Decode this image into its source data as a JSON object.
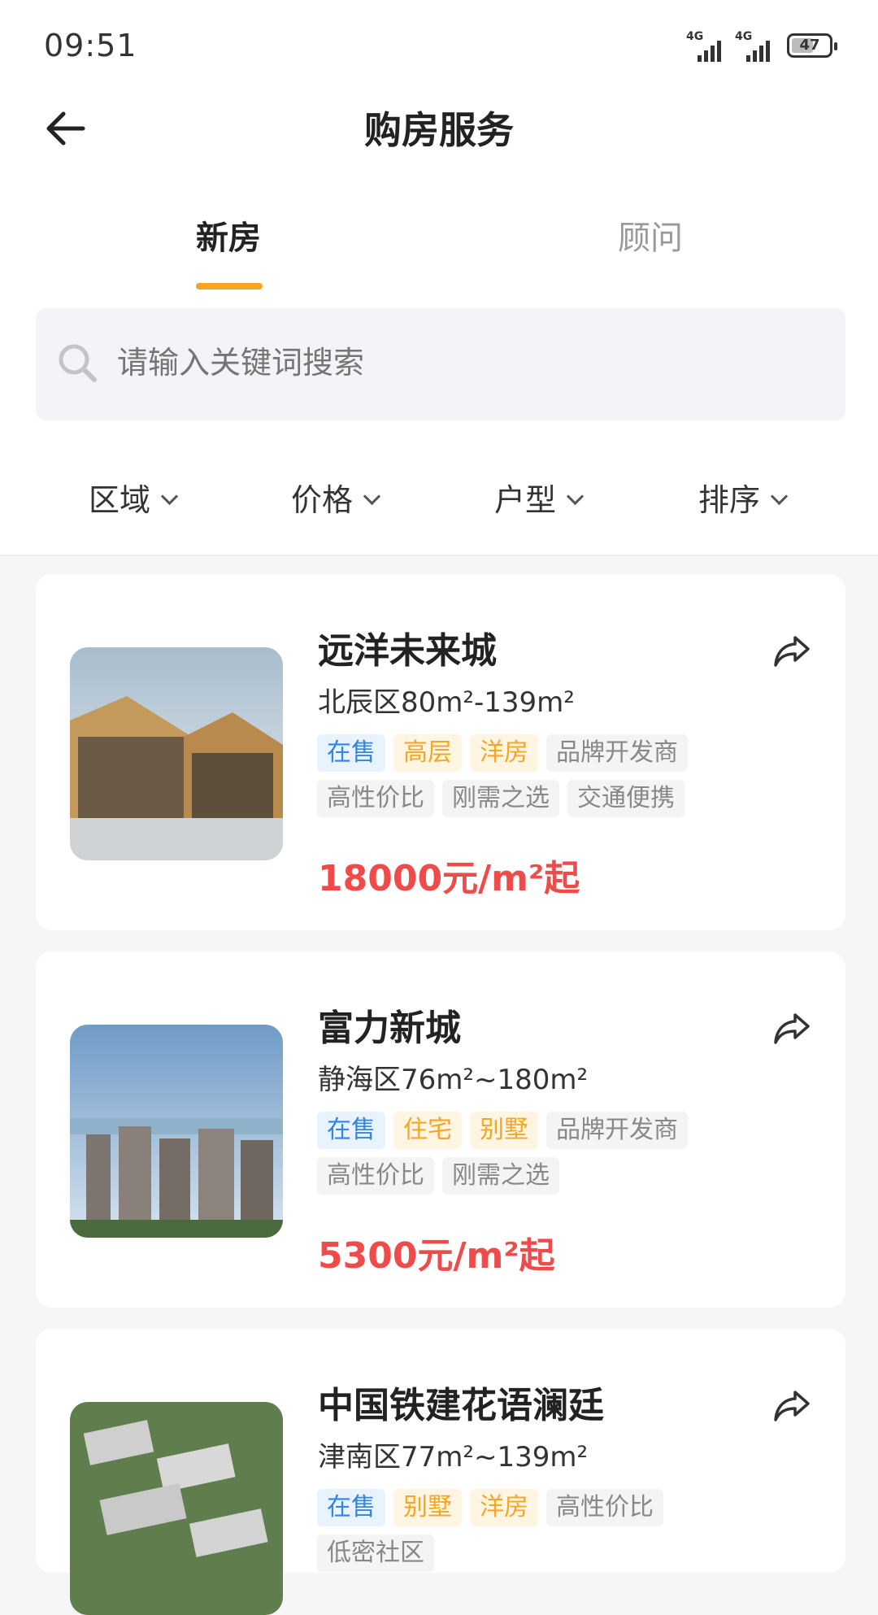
{
  "status_bar": {
    "time": "09:51",
    "battery": "47",
    "network": "4G"
  },
  "header": {
    "title": "购房服务"
  },
  "tabs": [
    {
      "label": "新房"
    },
    {
      "label": "顾问"
    }
  ],
  "search": {
    "placeholder": "请输入关键词搜索"
  },
  "filters": [
    {
      "label": "区域"
    },
    {
      "label": "价格"
    },
    {
      "label": "户型"
    },
    {
      "label": "排序"
    }
  ],
  "listings": [
    {
      "name": "远洋未来城",
      "area": "北辰区80m²-139m²",
      "tags": [
        "在售",
        "高层",
        "洋房",
        "品牌开发商",
        "高性价比",
        "刚需之选",
        "交通便携"
      ],
      "price": "18000元/m²起"
    },
    {
      "name": "富力新城",
      "area": "静海区76m²~180m²",
      "tags": [
        "在售",
        "住宅",
        "别墅",
        "品牌开发商",
        "高性价比",
        "刚需之选"
      ],
      "price": "5300元/m²起"
    },
    {
      "name": "中国铁建花语澜廷",
      "area": "津南区77m²~139m²",
      "tags": [
        "在售",
        "别墅",
        "洋房",
        "高性价比",
        "低密社区"
      ],
      "price": ""
    }
  ],
  "colors": {
    "accent": "#f5a623",
    "price": "#f04b4b",
    "tag_blue": "#2f86e4"
  }
}
